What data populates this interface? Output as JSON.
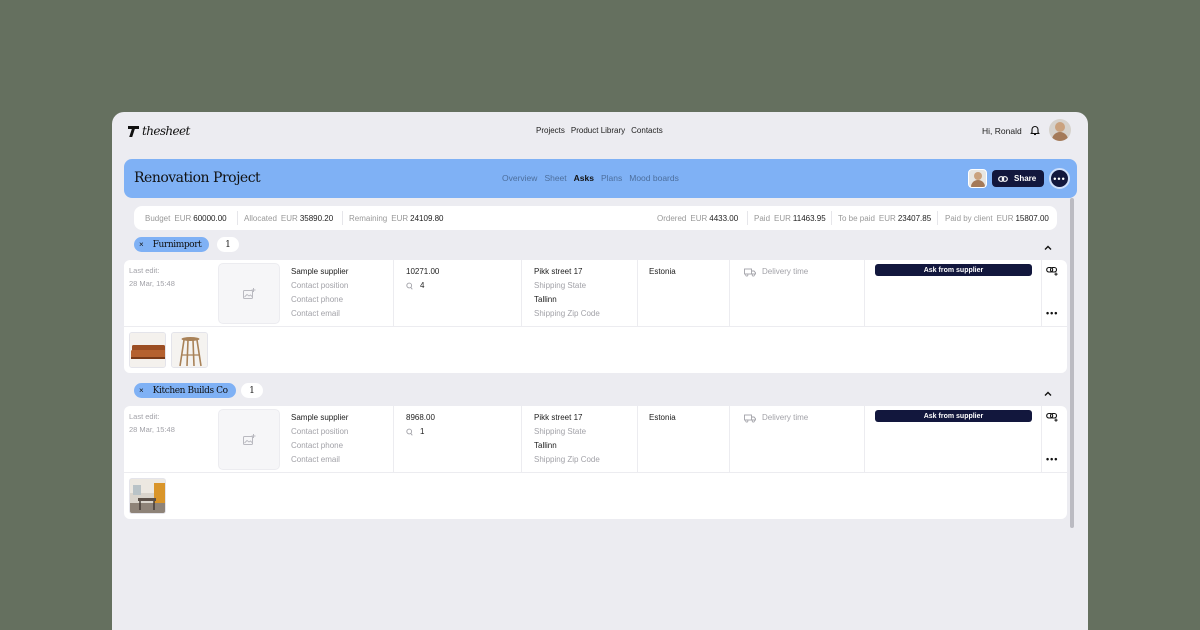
{
  "app": {
    "logo_text": "thesheet",
    "nav": [
      "Projects",
      "Product Library",
      "Contacts"
    ],
    "greeting": "Hi, Ronald"
  },
  "project": {
    "title": "Renovation Project",
    "tabs": [
      "Overview",
      "Sheet",
      "Asks",
      "Plans",
      "Mood boards"
    ],
    "active_tab": "Asks",
    "share_label": "Share"
  },
  "stats": {
    "budget": {
      "label": "Budget",
      "currency": "EUR",
      "value": "60000.00"
    },
    "allocated": {
      "label": "Allocated",
      "currency": "EUR",
      "value": "35890.20"
    },
    "remaining": {
      "label": "Remaining",
      "currency": "EUR",
      "value": "24109.80"
    },
    "ordered": {
      "label": "Ordered",
      "currency": "EUR",
      "value": "4433.00"
    },
    "paid": {
      "label": "Paid",
      "currency": "EUR",
      "value": "11463.95"
    },
    "to_be_paid": {
      "label": "To be paid",
      "currency": "EUR",
      "value": "23407.85"
    },
    "paid_by_client": {
      "label": "Paid by client",
      "currency": "EUR",
      "value": "15807.00"
    }
  },
  "groups": [
    {
      "name": "Furnimport",
      "count": "1",
      "last_edit_label": "Last edit:",
      "last_edit_date": "28 Mar, 15:48",
      "supplier": "Sample supplier",
      "contact_position": "Contact position",
      "contact_phone": "Contact phone",
      "contact_email": "Contact email",
      "amount": "10271.00",
      "quantity": "4",
      "street": "Pikk street 17",
      "state": "Shipping State",
      "city": "Tallinn",
      "zip": "Shipping Zip Code",
      "country": "Estonia",
      "delivery": "Delivery time",
      "ask_label": "Ask from supplier",
      "thumbnails": [
        "sofa",
        "stool"
      ]
    },
    {
      "name": "Kitchen Builds Co",
      "count": "1",
      "last_edit_label": "Last edit:",
      "last_edit_date": "28 Mar, 15:48",
      "supplier": "Sample supplier",
      "contact_position": "Contact position",
      "contact_phone": "Contact phone",
      "contact_email": "Contact email",
      "amount": "8968.00",
      "quantity": "1",
      "street": "Pikk street 17",
      "state": "Shipping State",
      "city": "Tallinn",
      "zip": "Shipping Zip Code",
      "country": "Estonia",
      "delivery": "Delivery time",
      "ask_label": "Ask from supplier",
      "thumbnails": [
        "kitchen"
      ]
    }
  ],
  "colors": {
    "background": "#65705f",
    "accent_blue": "#7fb1f5",
    "navy": "#12173d"
  }
}
